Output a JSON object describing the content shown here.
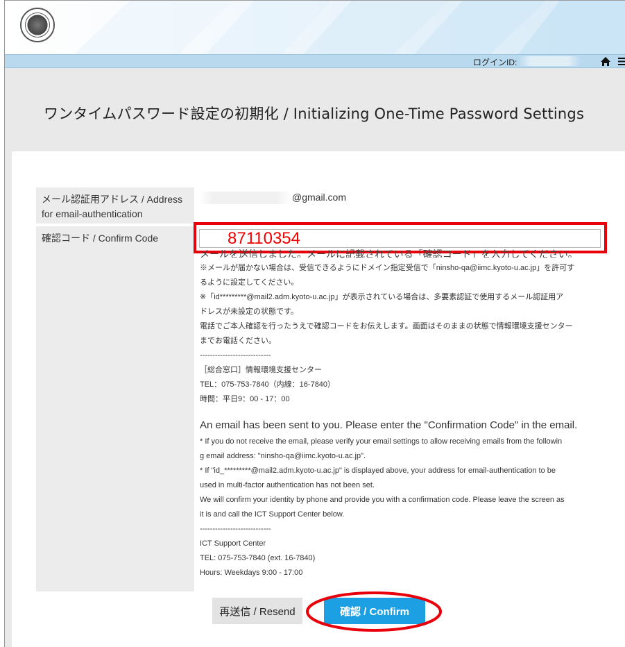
{
  "header": {
    "login_label": "ログインID:"
  },
  "page": {
    "title": "ワンタイムパスワード設定の初期化 / Initializing One-Time Password Settings"
  },
  "form": {
    "email_label": "メール認証用アドレス / Address for email-authentication",
    "email_value": "@gmail.com",
    "code_label": "確認コード / Confirm Code",
    "code_value": "87110354"
  },
  "instructions_jp": {
    "head": "メールを送信しました。メールに記載されている「確認コード」を入力してください。",
    "lines": [
      "※メールが届かない場合は、受信できるようにドメイン指定受信で「ninsho-qa@iimc.kyoto-u.ac.jp」を許可す",
      "るように設定してください。",
      "※「id*********@mail2.adm.kyoto-u.ac.jp」が表示されている場合は、多要素認証で使用するメール認証用ア",
      "ドレスが未設定の状態です。",
      "電話でご本人確認を行ったうえで確認コードをお伝えします。画面はそのままの状態で情報環境支援センター",
      "までお電話ください。",
      "----------------------------",
      "［総合窓口］情報環境支援センター",
      "TEL：075-753-7840（内線：16-7840）",
      "時間：平日9：00 - 17：00"
    ]
  },
  "instructions_en": {
    "head": "An email has been sent to you. Please enter the \"Confirmation Code\" in the email.",
    "lines": [
      "* If you do not receive the email, please verify your email settings to allow receiving emails from the followin",
      "g email address: \"ninsho-qa@iimc.kyoto-u.ac.jp\".",
      "* If \"id_*********@mail2.adm.kyoto-u.ac.jp\" is displayed above, your address for email-authentication to be",
      "used in multi-factor authentication has not been set.",
      "We will confirm your identity by phone and provide you with a confirmation code. Please leave the screen as",
      "it is and call the ICT Support Center below.",
      "----------------------------",
      "ICT Support Center",
      "TEL: 075-753-7840 (ext. 16-7840)",
      "Hours: Weekdays 9:00 - 17:00"
    ]
  },
  "buttons": {
    "resend": "再送信 / Resend",
    "confirm": "確認 / Confirm"
  },
  "colors": {
    "header_bar": "#b9d9ee",
    "title_band": "#e9e9e9",
    "confirm_button": "#1ca0e3",
    "annotation_red": "#e8000b",
    "code_text": "#ee0000"
  },
  "icons": {
    "home": "home-icon",
    "menu": "hamburger-menu-icon",
    "logo": "university-seal-logo"
  }
}
